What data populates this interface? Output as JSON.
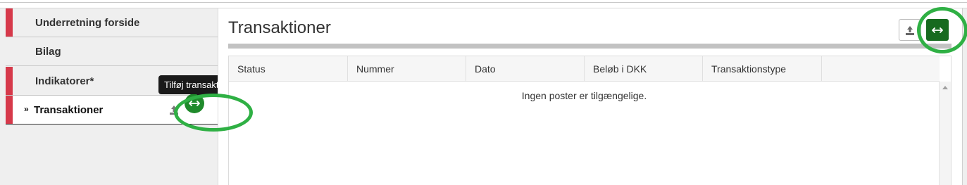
{
  "sidebar": {
    "items": [
      {
        "label": "Underretning forside"
      },
      {
        "label": "Bilag"
      },
      {
        "label": "Indikatorer*"
      },
      {
        "label": "Transaktioner"
      }
    ],
    "active_chevron": "»",
    "tooltip": "Tilføj transaktion"
  },
  "main": {
    "title": "Transaktioner",
    "columns": [
      "Status",
      "Nummer",
      "Dato",
      "Beløb i DKK",
      "Transaktionstype"
    ],
    "empty_message": "Ingen poster er tilgængelige."
  },
  "icons": {
    "export": "upload-icon",
    "add": "add-arrows-icon"
  },
  "colors": {
    "accent_red": "#d6394a",
    "primary_green": "#176a1f",
    "highlight_ring": "#2fb044"
  }
}
